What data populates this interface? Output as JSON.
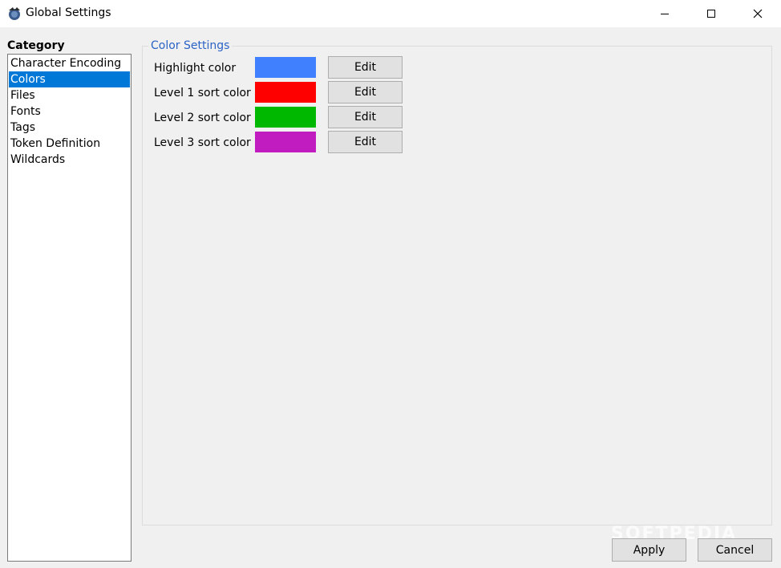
{
  "window": {
    "title": "Global Settings"
  },
  "category": {
    "label": "Category",
    "items": [
      {
        "label": "Character Encoding"
      },
      {
        "label": "Colors"
      },
      {
        "label": "Files"
      },
      {
        "label": "Fonts"
      },
      {
        "label": "Tags"
      },
      {
        "label": "Token Definition"
      },
      {
        "label": "Wildcards"
      }
    ],
    "selected": "Colors"
  },
  "color_settings": {
    "title": "Color Settings",
    "edit_label": "Edit",
    "rows": [
      {
        "label": "Highlight color",
        "color": "#4080ff"
      },
      {
        "label": "Level 1 sort color",
        "color": "#ff0000"
      },
      {
        "label": "Level 2 sort color",
        "color": "#00b800"
      },
      {
        "label": "Level 3 sort color",
        "color": "#c01cc0"
      }
    ]
  },
  "buttons": {
    "apply": "Apply",
    "cancel": "Cancel"
  },
  "watermark": "SOFTPEDIA"
}
